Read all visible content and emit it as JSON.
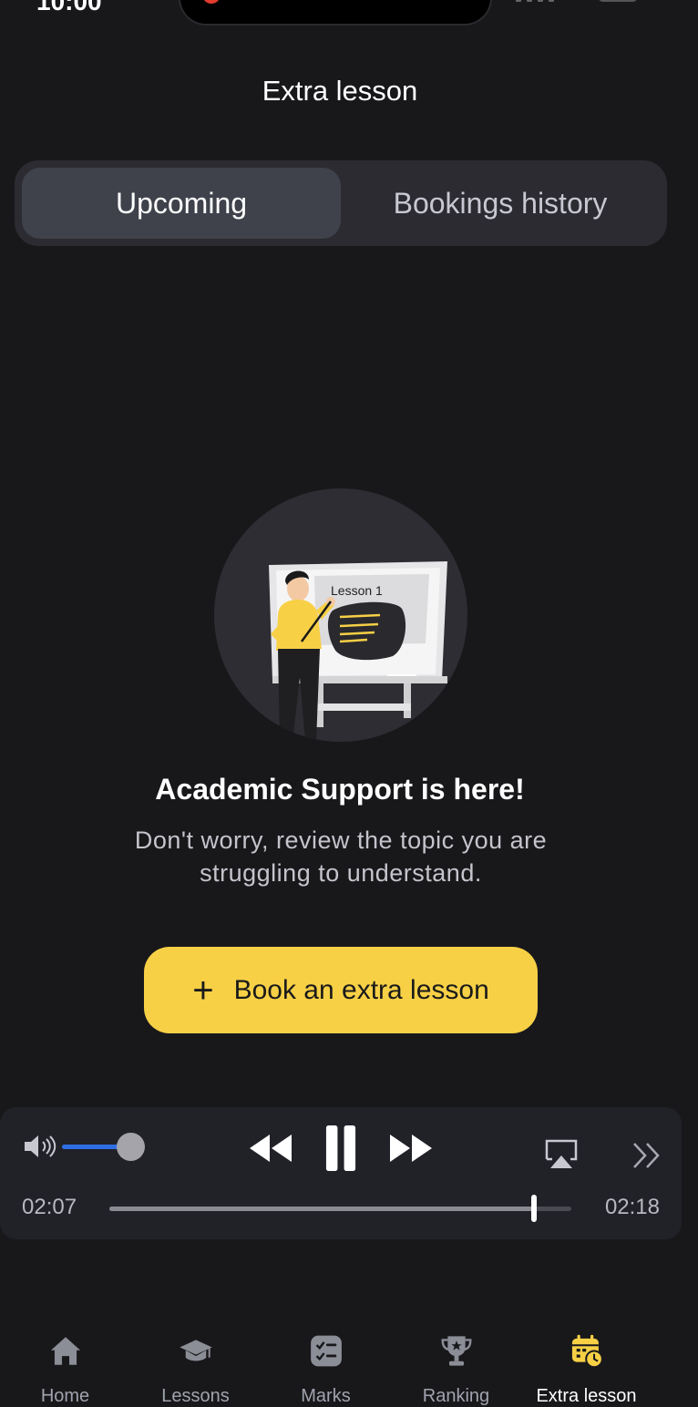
{
  "status_bar": {
    "time": "10:00"
  },
  "page": {
    "title": "Extra lesson"
  },
  "segments": [
    {
      "label": "Upcoming",
      "active": true
    },
    {
      "label": "Bookings history",
      "active": false
    }
  ],
  "illustration": {
    "board_text": "Lesson 1",
    "icon": "teacher-illustration"
  },
  "empty_state": {
    "heading": "Academic Support is here!",
    "description": "Don't worry, review the topic you are struggling to understand."
  },
  "cta": {
    "label": "Book an extra lesson",
    "color": "#f7d046"
  },
  "player": {
    "elapsed": "02:07",
    "total": "02:18",
    "progress": 0.92,
    "volume": 0.8,
    "accent": "#2f6fe6"
  },
  "tabbar": [
    {
      "label": "Home",
      "icon": "home-icon",
      "active": false
    },
    {
      "label": "Lessons",
      "icon": "graduation-cap-icon",
      "active": false
    },
    {
      "label": "Marks",
      "icon": "checklist-icon",
      "active": false
    },
    {
      "label": "Ranking",
      "icon": "trophy-icon",
      "active": false
    },
    {
      "label": "Extra lesson",
      "icon": "calendar-clock-icon",
      "active": true
    }
  ]
}
